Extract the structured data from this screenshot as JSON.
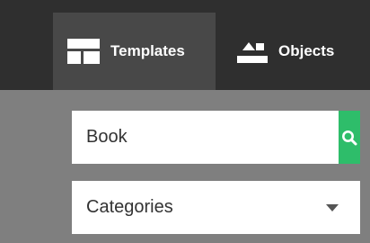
{
  "tabs": {
    "templates": {
      "label": "Templates",
      "icon": "layout-template-icon"
    },
    "objects": {
      "label": "Objects",
      "icon": "shapes-objects-icon"
    }
  },
  "search": {
    "value": "Book",
    "button_icon": "search-icon"
  },
  "categories": {
    "selected": "Categories",
    "icon": "caret-down-icon"
  },
  "colors": {
    "topbar": "#2f2f2f",
    "active_tab": "#484848",
    "panel_background": "#7f7f7f",
    "search_button": "#2ebd6a",
    "tab_text": "#ffffff"
  }
}
